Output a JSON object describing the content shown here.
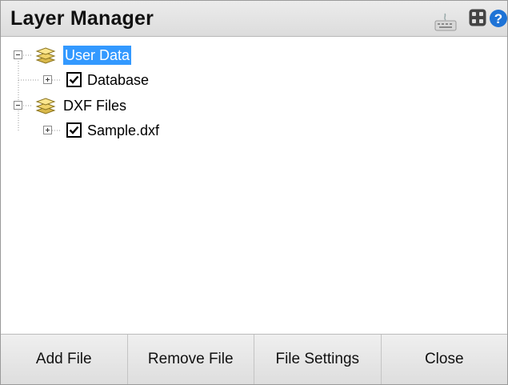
{
  "window": {
    "title": "Layer Manager",
    "toolbar_icons": [
      "keyboard-icon",
      "grid-view-icon",
      "help-icon"
    ]
  },
  "tree": {
    "nodes": [
      {
        "label": "User Data",
        "type": "group",
        "expanded": true,
        "selected": true,
        "icon": "layers-icon"
      },
      {
        "label": "Database",
        "type": "layer",
        "checked": true,
        "expanded": false
      },
      {
        "label": "DXF Files",
        "type": "group",
        "expanded": true,
        "selected": false,
        "icon": "layers-icon"
      },
      {
        "label": "Sample.dxf",
        "type": "layer",
        "checked": true,
        "expanded": false
      }
    ]
  },
  "buttons": {
    "add_file": "Add File",
    "remove_file": "Remove File",
    "file_settings": "File Settings",
    "close": "Close"
  },
  "colors": {
    "selection": "#3399ff",
    "help": "#1e73d6"
  }
}
